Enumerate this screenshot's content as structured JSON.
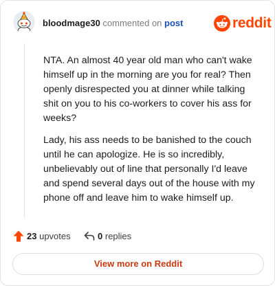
{
  "header": {
    "username": "bloodmage30",
    "action_text": "commented on",
    "post_link": "post",
    "brand": "reddit"
  },
  "comment": {
    "paragraphs": [
      "NTA. An almost 40 year old man who can't wake himself up in the morning are you for real? Then openly disrespected you at dinner while talking shit on you to his co-workers to cover his ass for weeks?",
      "Lady, his ass needs to be banished to the couch until he can apologize. He is so incredibly, unbelievably out of line that personally I'd leave and spend several days out of the house with my phone off and leave him to wake himself up."
    ]
  },
  "actions": {
    "upvotes_count": "23",
    "upvotes_label": "upvotes",
    "replies_count": "0",
    "replies_label": "replies"
  },
  "footer": {
    "view_more_label": "View more on Reddit"
  },
  "colors": {
    "brand_orange": "#ff4500",
    "link_blue": "#1a4fb4",
    "cta_text": "#c93a10",
    "border": "#e3e3e3"
  },
  "icons": {
    "avatar": "snoo-avatar-icon",
    "brand": "reddit-logo-icon",
    "upvote": "upvote-arrow-icon",
    "reply": "reply-arrow-icon"
  }
}
